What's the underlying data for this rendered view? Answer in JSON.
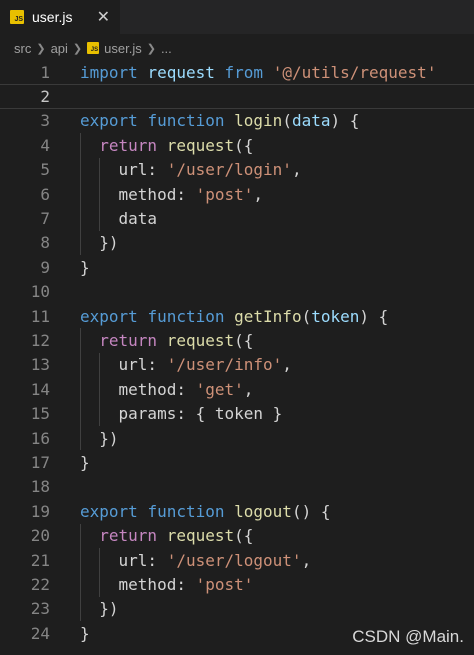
{
  "tab": {
    "badge": "JS",
    "label": "user.js",
    "close": "✕"
  },
  "breadcrumb": {
    "items": [
      "src",
      "api"
    ],
    "file_badge": "JS",
    "file": "user.js",
    "ellipsis": "..."
  },
  "editor": {
    "current_line": 2,
    "lines": [
      {
        "n": "1",
        "tokens": [
          [
            "kw",
            "import"
          ],
          [
            "p",
            " "
          ],
          [
            "var",
            "request"
          ],
          [
            "p",
            " "
          ],
          [
            "kw",
            "from"
          ],
          [
            "p",
            " "
          ],
          [
            "str",
            "'@/utils/request'"
          ]
        ]
      },
      {
        "n": "2",
        "tokens": []
      },
      {
        "n": "3",
        "tokens": [
          [
            "kw",
            "export"
          ],
          [
            "p",
            " "
          ],
          [
            "kw",
            "function"
          ],
          [
            "p",
            " "
          ],
          [
            "fn",
            "login"
          ],
          [
            "p",
            "("
          ],
          [
            "var",
            "data"
          ],
          [
            "p",
            ") {"
          ]
        ]
      },
      {
        "n": "4",
        "tokens": [
          [
            "p",
            "  "
          ],
          [
            "ctl",
            "return"
          ],
          [
            "p",
            " "
          ],
          [
            "fn",
            "request"
          ],
          [
            "p",
            "({"
          ]
        ]
      },
      {
        "n": "5",
        "tokens": [
          [
            "p",
            "    url: "
          ],
          [
            "str",
            "'/user/login'"
          ],
          [
            "p",
            ","
          ]
        ]
      },
      {
        "n": "6",
        "tokens": [
          [
            "p",
            "    method: "
          ],
          [
            "str",
            "'post'"
          ],
          [
            "p",
            ","
          ]
        ]
      },
      {
        "n": "7",
        "tokens": [
          [
            "p",
            "    data"
          ]
        ]
      },
      {
        "n": "8",
        "tokens": [
          [
            "p",
            "  })"
          ]
        ]
      },
      {
        "n": "9",
        "tokens": [
          [
            "p",
            "}"
          ]
        ]
      },
      {
        "n": "10",
        "tokens": []
      },
      {
        "n": "11",
        "tokens": [
          [
            "kw",
            "export"
          ],
          [
            "p",
            " "
          ],
          [
            "kw",
            "function"
          ],
          [
            "p",
            " "
          ],
          [
            "fn",
            "getInfo"
          ],
          [
            "p",
            "("
          ],
          [
            "var",
            "token"
          ],
          [
            "p",
            ") {"
          ]
        ]
      },
      {
        "n": "12",
        "tokens": [
          [
            "p",
            "  "
          ],
          [
            "ctl",
            "return"
          ],
          [
            "p",
            " "
          ],
          [
            "fn",
            "request"
          ],
          [
            "p",
            "({"
          ]
        ]
      },
      {
        "n": "13",
        "tokens": [
          [
            "p",
            "    url: "
          ],
          [
            "str",
            "'/user/info'"
          ],
          [
            "p",
            ","
          ]
        ]
      },
      {
        "n": "14",
        "tokens": [
          [
            "p",
            "    method: "
          ],
          [
            "str",
            "'get'"
          ],
          [
            "p",
            ","
          ]
        ]
      },
      {
        "n": "15",
        "tokens": [
          [
            "p",
            "    params: { token }"
          ]
        ]
      },
      {
        "n": "16",
        "tokens": [
          [
            "p",
            "  })"
          ]
        ]
      },
      {
        "n": "17",
        "tokens": [
          [
            "p",
            "}"
          ]
        ]
      },
      {
        "n": "18",
        "tokens": []
      },
      {
        "n": "19",
        "tokens": [
          [
            "kw",
            "export"
          ],
          [
            "p",
            " "
          ],
          [
            "kw",
            "function"
          ],
          [
            "p",
            " "
          ],
          [
            "fn",
            "logout"
          ],
          [
            "p",
            "() {"
          ]
        ]
      },
      {
        "n": "20",
        "tokens": [
          [
            "p",
            "  "
          ],
          [
            "ctl",
            "return"
          ],
          [
            "p",
            " "
          ],
          [
            "fn",
            "request"
          ],
          [
            "p",
            "({"
          ]
        ]
      },
      {
        "n": "21",
        "tokens": [
          [
            "p",
            "    url: "
          ],
          [
            "str",
            "'/user/logout'"
          ],
          [
            "p",
            ","
          ]
        ]
      },
      {
        "n": "22",
        "tokens": [
          [
            "p",
            "    method: "
          ],
          [
            "str",
            "'post'"
          ]
        ]
      },
      {
        "n": "23",
        "tokens": [
          [
            "p",
            "  })"
          ]
        ]
      },
      {
        "n": "24",
        "tokens": [
          [
            "p",
            "}"
          ]
        ]
      }
    ]
  },
  "watermark": "CSDN @Main.",
  "colors": {
    "background": "#1e1e1e",
    "keyword": "#569cd6",
    "control": "#c586c0",
    "function": "#dcdcaa",
    "string": "#ce9178",
    "variable": "#9cdcfe",
    "text": "#d4d4d4",
    "line_number": "#858585"
  }
}
